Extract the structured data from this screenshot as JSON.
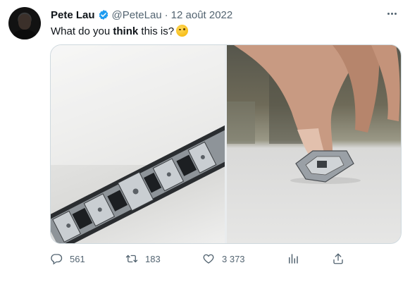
{
  "tweet": {
    "author_name": "Pete Lau",
    "author_handle": "@PeteLau",
    "separator": "·",
    "date": "12 août 2022",
    "text_before": "What do you ",
    "text_bold": "think",
    "text_after": " this is?",
    "emoji": "winking-face-emoji"
  },
  "metrics": {
    "replies": "561",
    "retweets": "183",
    "likes": "3 373"
  },
  "colors": {
    "verified": "#1d9bf0",
    "secondary_text": "#536471",
    "border": "#cfd9de"
  },
  "icons": [
    "verified-badge-icon",
    "more-options-icon",
    "reply-icon",
    "retweet-icon",
    "like-icon",
    "views-icon",
    "share-icon"
  ]
}
